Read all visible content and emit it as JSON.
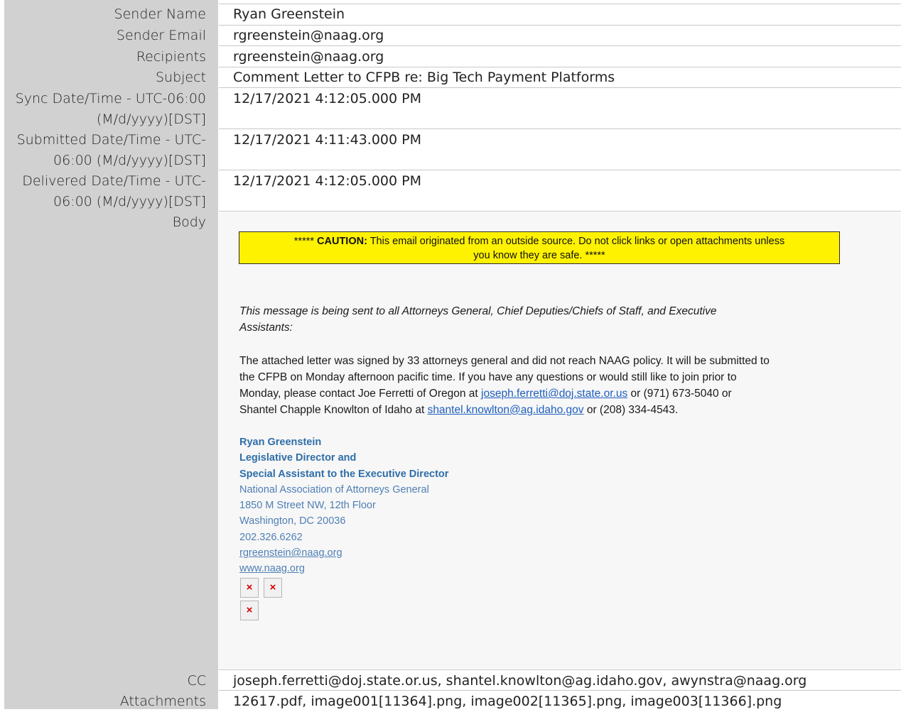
{
  "fields": {
    "sender_name": {
      "label": "Sender Name",
      "value": "Ryan Greenstein"
    },
    "sender_email": {
      "label": "Sender Email",
      "value": "rgreenstein@naag.org"
    },
    "recipients": {
      "label": "Recipients",
      "value": "rgreenstein@naag.org"
    },
    "subject": {
      "label": "Subject",
      "value": "Comment Letter to CFPB re: Big Tech Payment Platforms"
    },
    "sync": {
      "label1": "Sync Date/Time - UTC-06:00",
      "label2": "(M/d/yyyy)[DST]",
      "value": "12/17/2021 4:12:05.000 PM"
    },
    "submitted": {
      "label1": "Submitted Date/Time - UTC-",
      "label2": "06:00 (M/d/yyyy)[DST]",
      "value": "12/17/2021 4:11:43.000 PM"
    },
    "delivered": {
      "label1": "Delivered Date/Time - UTC-",
      "label2": "06:00 (M/d/yyyy)[DST]",
      "value": "12/17/2021 4:12:05.000 PM"
    },
    "body": {
      "label": "Body"
    },
    "cc": {
      "label": "CC",
      "value": "joseph.ferretti@doj.state.or.us, shantel.knowlton@ag.idaho.gov, awynstra@naag.org"
    },
    "attachments": {
      "label": "Attachments",
      "value": "12617.pdf, image001[11364].png, image002[11365].png, image003[11366].png"
    }
  },
  "body": {
    "caution_prefix": "*****",
    "caution_word": "CAUTION:",
    "caution_text": "This email originated from an outside source. Do not click links or open attachments unless",
    "caution_text2": "you know they are safe. *****",
    "intro_line1": "This message is being sent to all Attorneys General, Chief Deputies/Chiefs of Staff, and Executive",
    "intro_line2": "Assistants:",
    "p1_line1": "The attached letter was signed by 33 attorneys general and did not reach NAAG policy. It will be submitted to",
    "p1_line2": "the CFPB on Monday afternoon pacific time. If you have any questions or would still like to join prior to",
    "p1_line3_a": "Monday, please contact Joe Ferretti of Oregon at",
    "p1_link1": "joseph.ferretti@doj.state.or.us",
    "p1_line3_b": "or (971) 673-5040 or",
    "p1_line4_a": "Shantel Chapple Knowlton of Idaho at",
    "p1_link2": "shantel.knowlton@ag.idaho.gov",
    "p1_line4_b": "or (208) 334-4543.",
    "sig_name": "Ryan Greenstein",
    "sig_title1": "Legislative Director and",
    "sig_title2": "Special Assistant to the Executive Director",
    "sig_org": "National Association of Attorneys General",
    "sig_addr1": "1850 M Street NW, 12th Floor",
    "sig_addr2": "Washington, DC 20036",
    "sig_phone": "202.326.6262",
    "sig_email": "rgreenstein@naag.org",
    "sig_web": "www.naag.org",
    "broken_image_glyph": "×"
  }
}
